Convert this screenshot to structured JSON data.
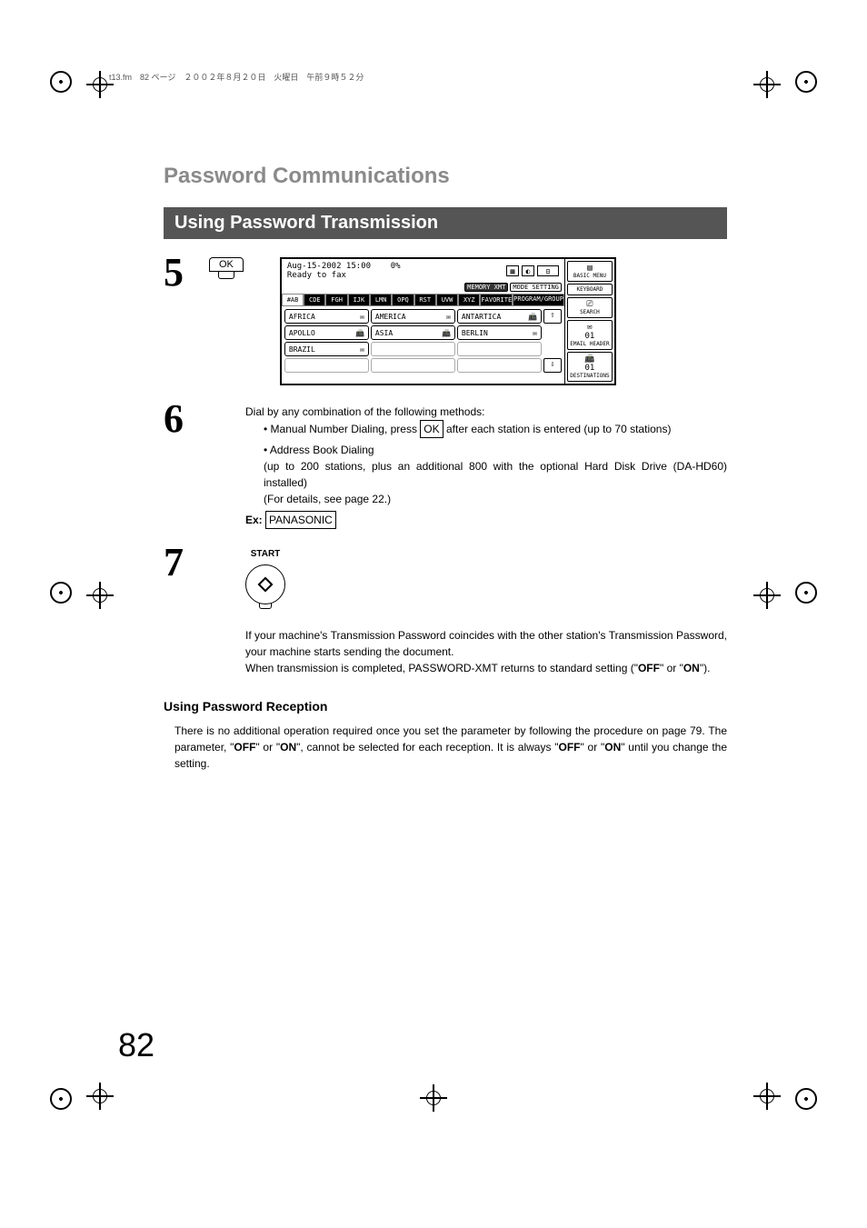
{
  "header_note": "t13.fm　82 ページ　２００２年８月２０日　火曜日　午前９時５２分",
  "title_main": "Password Communications",
  "title_bar": "Using Password Transmission",
  "steps": {
    "s5": {
      "num": "5",
      "ok_label": "OK"
    },
    "s6": {
      "num": "6",
      "intro": "Dial by any combination of the following methods:",
      "bullets": [
        {
          "pre": "Manual Number Dialing, press ",
          "boxed": "OK",
          "post": " after each station is entered (up to 70 stations)"
        },
        {
          "line1": "Address Book Dialing",
          "line2": "(up to 200 stations, plus an additional 800 with the optional Hard Disk Drive (DA-HD60) installed)",
          "line3": "(For details, see page 22.)"
        }
      ],
      "ex_label": "Ex:",
      "ex_value": "PANASONIC"
    },
    "s7": {
      "num": "7",
      "start_label": "START",
      "para1": "If your machine's Transmission Password coincides with the other station's Transmission Password, your machine starts sending the document.",
      "para2_pre": "When transmission is completed, PASSWORD-XMT returns to standard setting (\"",
      "para2_b1": "OFF",
      "para2_mid": "\" or \"",
      "para2_b2": "ON",
      "para2_post": "\")."
    }
  },
  "screen": {
    "date": "Aug-15-2002 15:00",
    "pct": "0%",
    "status": "Ready to fax",
    "top_btns": {
      "memory": "MEMORY XMT",
      "mode": "MODE SETTING"
    },
    "tabs": [
      "#AB",
      "CDE",
      "FGH",
      "IJK",
      "LMN",
      "OPQ",
      "RST",
      "UVW",
      "XYZ",
      "FAVORITE",
      "PROGRAM/GROUP"
    ],
    "entries": [
      [
        "AFRICA",
        "AMERICA",
        "ANTARTICA"
      ],
      [
        "APOLLO",
        "ASIA",
        "BERLIN"
      ],
      [
        "BRAZIL",
        "",
        ""
      ],
      [
        "",
        "",
        ""
      ]
    ],
    "side": [
      "BASIC MENU",
      "KEYBOARD",
      "SEARCH",
      "EMAIL HEADER",
      "DESTINATIONS"
    ],
    "side_nums": [
      "01",
      "01"
    ]
  },
  "reception": {
    "heading": "Using Password Reception",
    "p_pre": "There is no additional operation required once you set the parameter by following the procedure on page 79.  The parameter, \"",
    "b1": "OFF",
    "mid1": "\" or \"",
    "b2": "ON",
    "mid2": "\", cannot be selected for each reception.  It is always \"",
    "b3": "OFF",
    "mid3": "\" or \"",
    "b4": "ON",
    "post": "\" until you change the setting."
  },
  "page_num": "82"
}
